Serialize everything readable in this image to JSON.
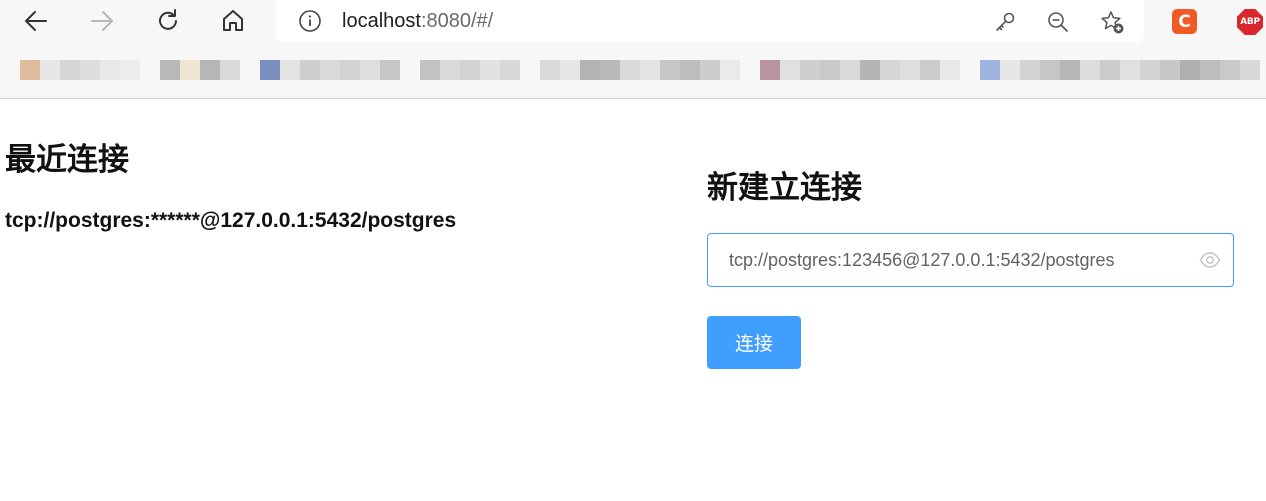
{
  "browser": {
    "address": {
      "host": "localhost",
      "rest": ":8080/#/"
    },
    "icons": {
      "back": "back-arrow-icon",
      "forward": "forward-arrow-icon",
      "reload": "reload-icon",
      "home": "home-icon",
      "info": "info-icon",
      "key": "key-icon",
      "zoom": "zoom-out-icon",
      "favorite": "add-favorite-icon"
    },
    "extensions": [
      {
        "label": "C",
        "color": "#f05a24"
      },
      {
        "label": "ABP",
        "color": "#d9272e"
      }
    ]
  },
  "recent": {
    "title": "最近连接",
    "items": [
      "tcp://postgres:******@127.0.0.1:5432/postgres"
    ]
  },
  "new_connection": {
    "title": "新建立连接",
    "input_value": "tcp://postgres:123456@127.0.0.1:5432/postgres",
    "connect_label": "连接"
  },
  "colors": {
    "accent": "#409eff",
    "chrome_bg": "#f7f7f7",
    "text": "#111111"
  }
}
